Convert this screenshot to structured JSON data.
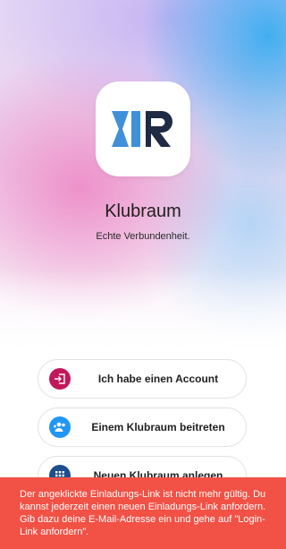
{
  "app": {
    "logo_text": "KR",
    "title": "Klubraum",
    "tagline": "Echte Verbundenheit."
  },
  "actions": [
    {
      "label": "Ich habe einen Account",
      "icon": "login-icon",
      "color": "#c2185b"
    },
    {
      "label": "Einem Klubraum beitreten",
      "icon": "group-add-icon",
      "color": "#2196f3"
    },
    {
      "label": "Neuen Klubraum anlegen",
      "icon": "apps-icon",
      "color": "#1e4e8c"
    }
  ],
  "toast": {
    "message": "Der angeklickte Einladungs-Link ist nicht mehr gültig. Du kannst jederzeit einen neuen Einladungs-Link anfordern. Gib dazu deine E-Mail-Adresse ein und gehe auf \"Login-Link anfordern\".",
    "color": "#f25145"
  },
  "colors": {
    "logo_blue": "#3f8fd9",
    "logo_navy": "#1f2a44"
  }
}
